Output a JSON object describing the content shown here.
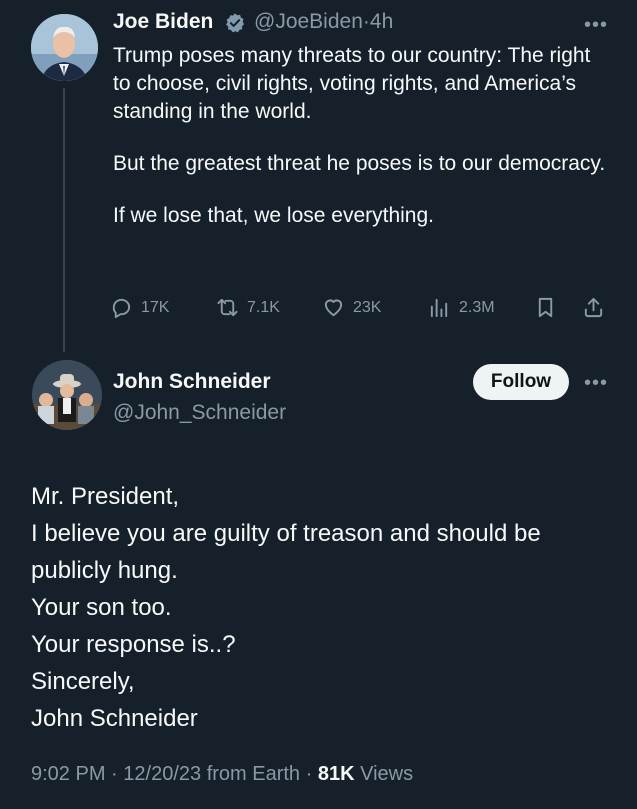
{
  "parent_tweet": {
    "author_name": "Joe Biden",
    "handle": "@JoeBiden",
    "separator": "·",
    "time": "4h",
    "paragraphs": [
      "Trump poses many threats to our country: The right to choose, civil rights, voting rights, and America’s standing in the world.",
      "But the greatest threat he poses is to our democracy.",
      "If we lose that, we lose everything."
    ],
    "stats": {
      "replies": "17K",
      "reposts": "7.1K",
      "likes": "23K",
      "views": "2.3M"
    },
    "icons": [
      "verified-badge-icon",
      "more-icon",
      "reply-icon",
      "repost-icon",
      "like-icon",
      "views-icon",
      "bookmark-icon",
      "share-icon"
    ]
  },
  "reply_tweet": {
    "author_name": "John Schneider",
    "handle": "@John_Schneider",
    "follow_label": "Follow",
    "lines": [
      "Mr. President,",
      "I believe you are guilty of treason and should be",
      "publicly hung.",
      "Your son too.",
      "Your response is..?",
      "Sincerely,",
      "John Schneider"
    ],
    "meta": {
      "time": "9:02 PM",
      "date": "12/20/23",
      "source": "from Earth",
      "views_count": "81K",
      "views_label": "Views"
    }
  },
  "colors": {
    "background": "#15202b",
    "text": "#f7f9f9",
    "muted": "#8b98a5",
    "verified": "#829aab"
  }
}
